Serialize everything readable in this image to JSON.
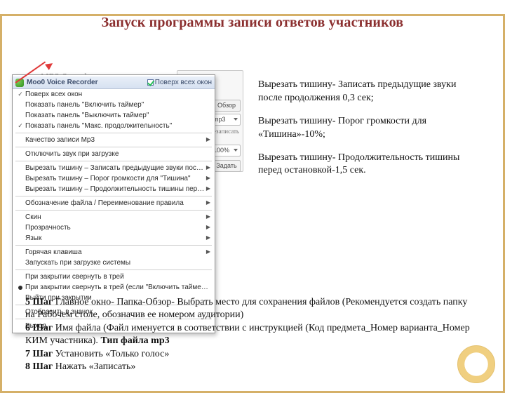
{
  "title": "Запуск программы записи ответов участников",
  "bg": {
    "appName": "MP3 Sound",
    "browse": "Обзор",
    "format": "mp3",
    "rewriteHint": "ерезаписать",
    "percent": "100%",
    "setBtn": "Задать"
  },
  "menu": {
    "title": "Moo0 Voice Recorder",
    "topCheck": "Поверх всех окон",
    "items": {
      "g0": [
        "Поверх всех окон",
        "Показать панель \"Включить таймер\"",
        "Показать панель \"Выключить таймер\"",
        "Показать панель \"Макс. продолжительность\""
      ],
      "g1": [
        "Качество записи Mp3"
      ],
      "g2": [
        "Отключить звук при загрузке"
      ],
      "g3": [
        "Вырезать тишину – Записать предыдущие звуки после продолжения",
        "Вырезать тишину – Порог громкости для \"Тишина\"",
        "Вырезать тишину – Продолжительность тишины перед остановкой"
      ],
      "g4": [
        "Обозначение файла / Переименование правила"
      ],
      "g5": [
        "Скин",
        "Прозрачность",
        "Язык"
      ],
      "g6": [
        "Горячая клавиша",
        "Запускать при загрузке системы"
      ],
      "g7": [
        "При закрытии свернуть в трей",
        "При закрытии свернуть в трей (если \"Включить таймер\" включено)",
        "Выйти при закрытии"
      ],
      "g8": [
        "Отобразить в значок"
      ],
      "g9": [
        "Выход"
      ]
    }
  },
  "right": {
    "p1": "Вырезать тишину- Записать предыдущие звуки после продолжения 0,3 сек;",
    "p2": "Вырезать тишину- Порог громкости для «Тишина»-10%;",
    "p3": "Вырезать тишину- Продолжительность тишины перед  остановкой-1,5 сек."
  },
  "steps": {
    "s5b": "5 Шаг",
    "s5": " Главное окно- Папка-Обзор- Выбрать место для сохранения файлов (Рекомендуется создать папку на Рабочем столе, обозначив ее номером аудитории)",
    "s6b": "6 Шаг",
    "s6a": " Имя файла (Файл именуется в соответствии с инструкцией (Код предмета_Номер варианта_Номер КИМ участника). ",
    "s6type": "Тип файла mp3",
    "s7b": "7 Шаг",
    "s7": " Установить «Только голос»",
    "s8b": "8 Шаг",
    "s8": " Нажать «Записать»"
  }
}
